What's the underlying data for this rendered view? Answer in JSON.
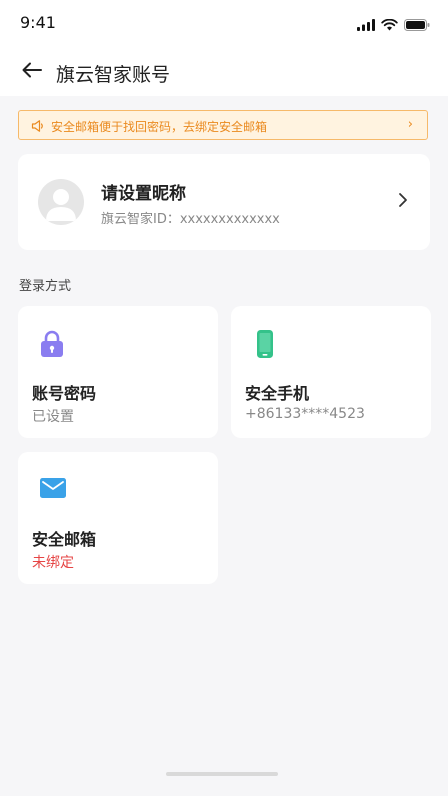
{
  "status_bar": {
    "time": "9:41"
  },
  "nav": {
    "title": "旗云智家账号"
  },
  "notice": {
    "text": "安全邮箱便于找回密码，去绑定安全邮箱",
    "chevron": "›"
  },
  "profile": {
    "nickname": "请设置昵称",
    "account_id": "旗云智家ID：xxxxxxxxxxxxx"
  },
  "login_section": {
    "title": "登录方式",
    "methods": [
      {
        "title": "账号密码",
        "status": "已设置",
        "icon": "lock-icon",
        "icon_color": "#8a7df0"
      },
      {
        "title": "安全手机",
        "status": "+86133****4523",
        "icon": "phone-icon",
        "icon_color": "#34c28a"
      },
      {
        "title": "安全邮箱",
        "status": "未绑定",
        "icon": "mail-icon",
        "icon_color": "#3aa2e8",
        "status_color": "#e64545"
      }
    ]
  },
  "colors": {
    "accent_orange": "#ea8a1f",
    "notice_bg": "#fff3e0",
    "page_bg": "#f6f6f8"
  }
}
